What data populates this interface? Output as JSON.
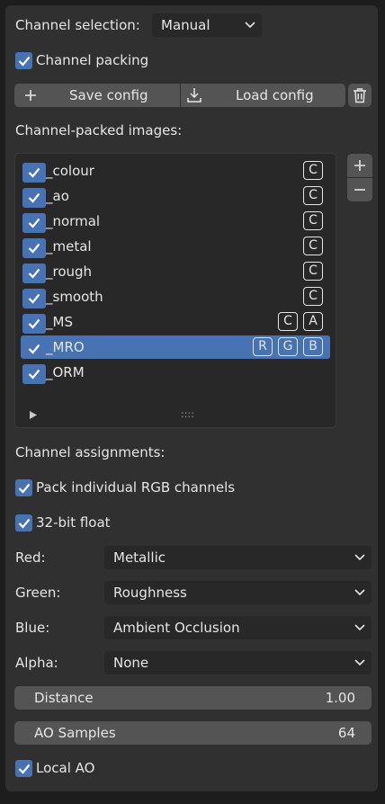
{
  "channel_selection": {
    "label": "Channel selection:",
    "value": "Manual"
  },
  "channel_packing": {
    "label": "Channel packing",
    "checked": true
  },
  "config": {
    "save_label": "Save config",
    "load_label": "Load config"
  },
  "images_header": "Channel-packed images:",
  "images": [
    {
      "label": "_colour",
      "tags": [
        "C"
      ],
      "selected": false
    },
    {
      "label": "_ao",
      "tags": [
        "C"
      ],
      "selected": false
    },
    {
      "label": "_normal",
      "tags": [
        "C"
      ],
      "selected": false
    },
    {
      "label": "_metal",
      "tags": [
        "C"
      ],
      "selected": false
    },
    {
      "label": "_rough",
      "tags": [
        "C"
      ],
      "selected": false
    },
    {
      "label": "_smooth",
      "tags": [
        "C"
      ],
      "selected": false
    },
    {
      "label": "_MS",
      "tags": [
        "C",
        "A"
      ],
      "selected": false
    },
    {
      "label": "_MRO",
      "tags": [
        "R",
        "G",
        "B"
      ],
      "selected": true
    },
    {
      "label": "_ORM",
      "tags": [],
      "selected": false
    }
  ],
  "list_footer": {
    "expand_icon": "triangle-right-icon",
    "grip": "::::"
  },
  "assignments_header": "Channel assignments:",
  "pack_rgb": {
    "label": "Pack individual RGB channels",
    "checked": true
  },
  "float32": {
    "label": "32-bit float",
    "checked": true
  },
  "channels": {
    "red": {
      "label": "Red:",
      "value": "Metallic"
    },
    "green": {
      "label": "Green:",
      "value": "Roughness"
    },
    "blue": {
      "label": "Blue:",
      "value": "Ambient Occlusion"
    },
    "alpha": {
      "label": "Alpha:",
      "value": "None"
    }
  },
  "distance": {
    "label": "Distance",
    "value": "1.00"
  },
  "ao_samples": {
    "label": "AO Samples",
    "value": "64"
  },
  "local_ao": {
    "label": "Local AO",
    "checked": true
  },
  "colors": {
    "accent": "#4772b3",
    "panel": "#303030",
    "field": "#282828",
    "button": "#545454"
  }
}
